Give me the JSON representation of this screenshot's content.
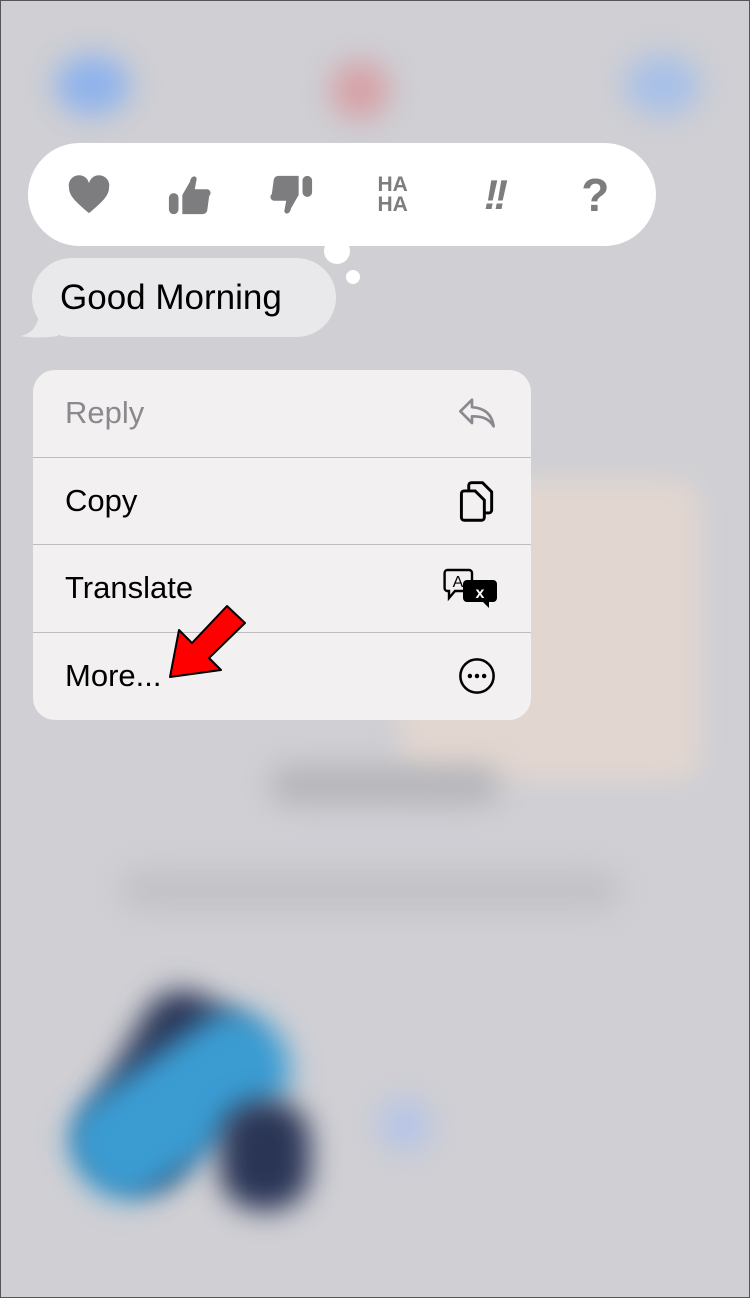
{
  "tapback": {
    "reactions": [
      {
        "icon": "heart-icon"
      },
      {
        "icon": "thumbs-up-icon"
      },
      {
        "icon": "thumbs-down-icon"
      },
      {
        "icon": "haha-icon",
        "text": "HA HA"
      },
      {
        "icon": "exclamation-icon",
        "text": "!!"
      },
      {
        "icon": "question-icon",
        "text": "?"
      }
    ]
  },
  "message": {
    "text": "Good Morning"
  },
  "menu": {
    "items": [
      {
        "label": "Reply",
        "icon": "reply-icon"
      },
      {
        "label": "Copy",
        "icon": "copy-icon"
      },
      {
        "label": "Translate",
        "icon": "translate-icon"
      },
      {
        "label": "More...",
        "icon": "more-icon"
      }
    ]
  },
  "annotation": {
    "arrow_color": "#ff0000"
  }
}
